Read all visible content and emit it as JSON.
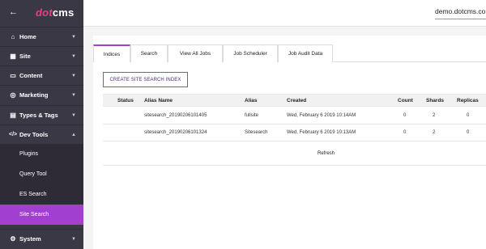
{
  "sidebar": {
    "back_icon": "arrow-left-icon",
    "logo_dot": "dot",
    "logo_cms": "cms",
    "items": [
      {
        "label": "Home",
        "icon": "home-icon",
        "glyph": "⌂"
      },
      {
        "label": "Site",
        "icon": "sitemap-icon",
        "glyph": "▦"
      },
      {
        "label": "Content",
        "icon": "folder-icon",
        "glyph": "▭"
      },
      {
        "label": "Marketing",
        "icon": "bullseye-icon",
        "glyph": "◎"
      },
      {
        "label": "Types & Tags",
        "icon": "file-icon",
        "glyph": "▤"
      },
      {
        "label": "Dev Tools",
        "icon": "code-icon",
        "glyph": "</>"
      }
    ],
    "subitems": [
      {
        "label": "Plugins"
      },
      {
        "label": "Query Tool"
      },
      {
        "label": "ES Search"
      },
      {
        "label": "Site Search"
      }
    ],
    "system": {
      "label": "System",
      "icon": "gear-icon",
      "glyph": "⚙"
    }
  },
  "header": {
    "host": "demo.dotcms.co"
  },
  "tabs": [
    {
      "label": "Indices"
    },
    {
      "label": "Search"
    },
    {
      "label": "View All Jobs"
    },
    {
      "label": "Job Scheduler"
    },
    {
      "label": "Job Audit Data"
    }
  ],
  "create_button": "CREATE SITE SEARCH INDEX",
  "table": {
    "headers": {
      "status": "Status",
      "alias_name": "Alias Name",
      "alias": "Alias",
      "created": "Created",
      "count": "Count",
      "shards": "Shards",
      "replicas": "Replicas"
    },
    "rows": [
      {
        "alias_name": "sitesearch_20190206101405",
        "alias": "fullsite",
        "created": "Wed, February 6 2019 10:14AM",
        "count": "0",
        "shards": "2",
        "replicas": "0"
      },
      {
        "alias_name": "sitesearch_20190206101324",
        "alias": "Sitesearch",
        "created": "Wed, February 6 2019 10:13AM",
        "count": "0",
        "shards": "2",
        "replicas": "0"
      }
    ],
    "refresh": "Refresh"
  },
  "colors": {
    "sidebar_bg": "#3a3845",
    "accent": "#a13fd1",
    "logo_dot": "#e93f82"
  }
}
